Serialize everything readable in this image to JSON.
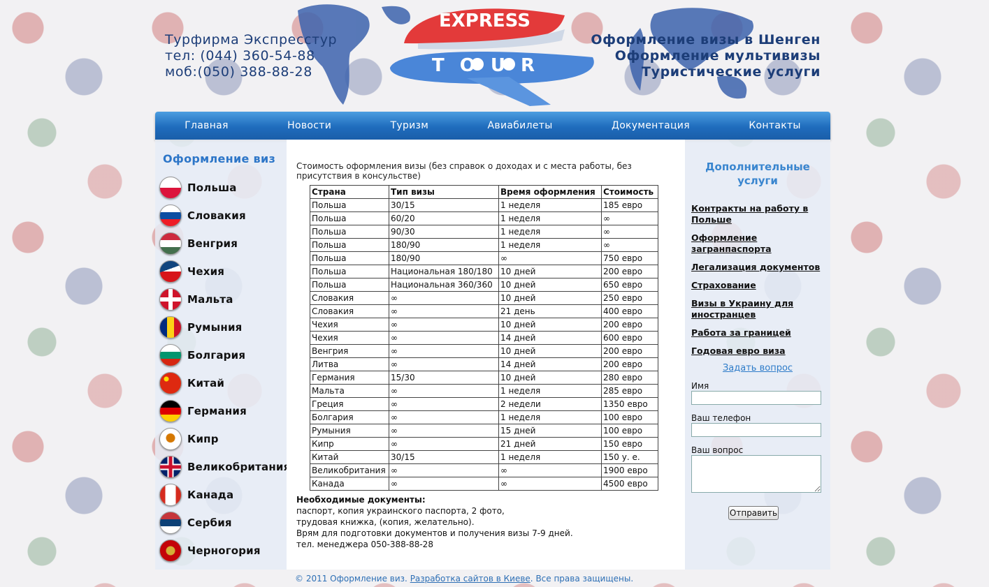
{
  "header": {
    "company": "Турфирма Экспресстур",
    "phone": "тел: (044) 360-54-88",
    "mobile": "моб:(050) 388-88-28",
    "services": [
      "Оформление визы в Шенген",
      "Оформление мультивизы",
      "Туристические услуги"
    ],
    "logo_top": "EXPRESS",
    "logo_bottom": "TOUR"
  },
  "nav": [
    "Главная",
    "Новости",
    "Туризм",
    "Авиабилеты",
    "Документация",
    "Контакты"
  ],
  "sidebar": {
    "title": "Оформление виз",
    "countries": [
      "Польша",
      "Словакия",
      "Венгрия",
      "Чехия",
      "Мальта",
      "Румыния",
      "Болгария",
      "Китай",
      "Германия",
      "Кипр",
      "Великобритания",
      "Канада",
      "Сербия",
      "Черногория"
    ]
  },
  "main": {
    "intro": "Стоимость оформления визы (без справок о доходах и с места работы, без присутствия в консульстве)",
    "headers": [
      "Страна",
      "Тип визы",
      "Время оформления",
      "Стоимость"
    ],
    "rows": [
      [
        "Польша",
        "30/15",
        "1 неделя",
        "185 евро"
      ],
      [
        "Польша",
        "60/20",
        "1 неделя",
        "∞"
      ],
      [
        "Польша",
        "90/30",
        "1 неделя",
        "∞"
      ],
      [
        "Польша",
        "180/90",
        "1 неделя",
        "∞"
      ],
      [
        "Польша",
        "180/90",
        "∞",
        "750 евро"
      ],
      [
        "Польша",
        "Национальная 180/180",
        "10 дней",
        "200 евро"
      ],
      [
        "Польша",
        "Национальная 360/360",
        "10 дней",
        "650 евро"
      ],
      [
        "Словакия",
        "∞",
        "10 дней",
        "250 евро"
      ],
      [
        "Словакия",
        "∞",
        "21 день",
        "400 евро"
      ],
      [
        "Чехия",
        "∞",
        "10 дней",
        "200 евро"
      ],
      [
        "Чехия",
        "∞",
        "14 дней",
        "600 евро"
      ],
      [
        "Венгрия",
        "∞",
        "10 дней",
        "200 евро"
      ],
      [
        "Литва",
        "∞",
        "14 дней",
        "200 евро"
      ],
      [
        "Германия",
        "15/30",
        "10 дней",
        "280 евро"
      ],
      [
        "Мальта",
        "∞",
        "1 неделя",
        "285 евро"
      ],
      [
        "Греция",
        "∞",
        "2 недели",
        "1350 евро"
      ],
      [
        "Болгария",
        "∞",
        "1 неделя",
        "100 евро"
      ],
      [
        "Румыния",
        "∞",
        "15 дней",
        "100 евро"
      ],
      [
        "Кипр",
        "∞",
        "21 дней",
        "150 евро"
      ],
      [
        "Китай",
        "30/15",
        "1 неделя",
        "150  у. е."
      ],
      [
        "Великобритания",
        "∞",
        "∞",
        "1900 евро"
      ],
      [
        "Канада",
        "∞",
        "∞",
        "4500 евро"
      ]
    ],
    "docs_title": "Необходимые документы:",
    "docs_lines": [
      "паспорт, копия украинского паспорта, 2 фото,",
      "трудовая книжка, (копия, желательно).",
      "Врям для подготовки документов и получения визы 7-9 дней.",
      "тел. менеджера 050-388-88-28"
    ]
  },
  "right": {
    "title": "Дополнительные услуги",
    "services": [
      "Контракты на работу в Польше",
      "Оформление загранпаспорта",
      "Легализация документов",
      "Страхование",
      "Визы в Украину для иностранцев",
      "Работа за границей",
      "Годовая евро виза"
    ],
    "ask": "Задать вопрос",
    "name_label": "Имя",
    "phone_label": "Ваш телефон",
    "question_label": "Ваш вопрос",
    "submit": "Отправить"
  },
  "footer": {
    "copyright": "© 2011 Оформление виз.",
    "link": "Разработка сайтов в Киеве",
    "rights": "Все права защищены."
  }
}
